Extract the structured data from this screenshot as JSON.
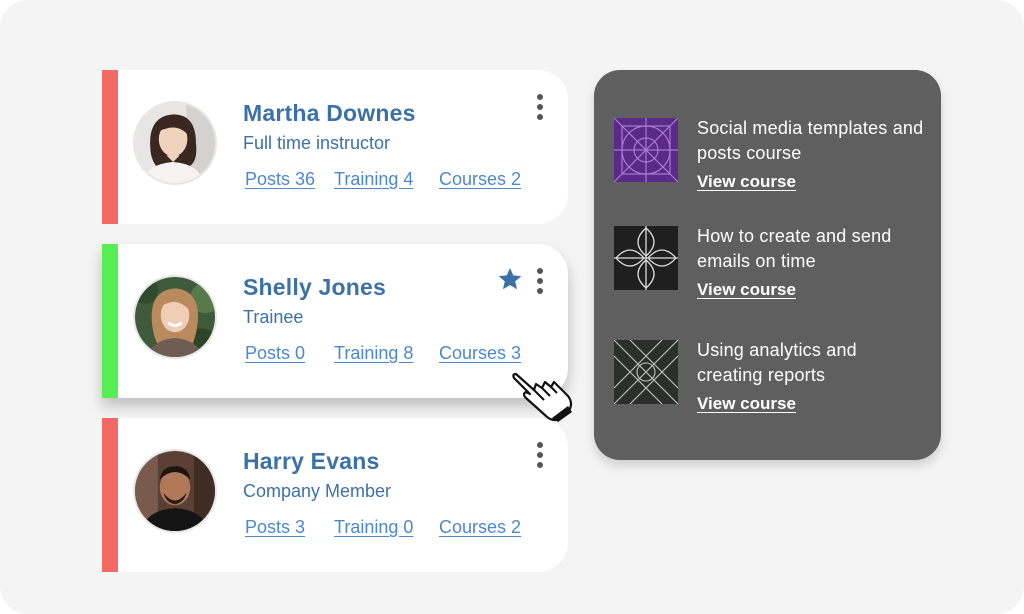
{
  "colors": {
    "status_red": "#f26a63",
    "status_green": "#55ee55",
    "name_blue": "#3b71a7",
    "link_blue": "#4d88cc",
    "panel_bg": "#5f5f5f"
  },
  "members": [
    {
      "name": "Martha Downes",
      "role": "Full time instructor",
      "posts": "Posts 36",
      "training": "Training  4",
      "courses": "Courses  2",
      "status": "red",
      "starred": false
    },
    {
      "name": "Shelly Jones",
      "role": "Trainee",
      "posts": "Posts 0",
      "training": "Training  8",
      "courses": "Courses  3",
      "status": "green",
      "starred": true
    },
    {
      "name": "Harry Evans",
      "role": "Company Member",
      "posts": "Posts 3",
      "training": "Training  0",
      "courses": "Courses  2",
      "status": "red",
      "starred": false
    }
  ],
  "icons": {
    "menu": "more-vertical-icon",
    "star": "star-icon",
    "cursor": "hand-pointer-icon"
  },
  "courses": [
    {
      "title": "Social media templates and posts course",
      "link": "View course",
      "thumb_color": "#5a2a86"
    },
    {
      "title": "How to create and send emails on time",
      "link": "View course",
      "thumb_color": "#1f1f1f"
    },
    {
      "title": "Using analytics and creating reports",
      "link": "View course",
      "thumb_color": "#2a2f2c"
    }
  ]
}
